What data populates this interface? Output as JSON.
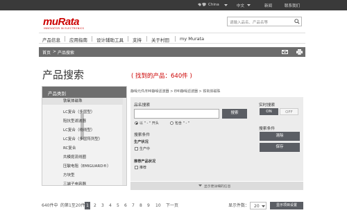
{
  "topbar": {
    "region": "China",
    "language": "中文",
    "news": "新闻",
    "contact": "联系我们"
  },
  "brand": {
    "logo": "muRata",
    "tagline": "INNOVATOR IN ELECTRONICS"
  },
  "search": {
    "placeholder": "请输入品名、产品名等"
  },
  "nav": {
    "items": [
      "产品信息",
      "应用指南",
      "设计辅助工具",
      "支持",
      "关于村田",
      "my Murata"
    ]
  },
  "breadcrumb": {
    "home": "首页",
    "current": "产品搜索"
  },
  "page": {
    "title": "产品搜索",
    "found": "( 找到的产品：640件 )"
  },
  "category": {
    "header": "产品类别",
    "items": [
      "铁氧体磁珠",
      "LC复合（多层型）",
      "阻抗型滤波器",
      "LC复合（绕线型）",
      "LC复合（多层阵列型）",
      "RC复合",
      "共模扼流线圈",
      "压敏电阻（EMIGUARD®）",
      "方块型",
      "三端子电容器"
    ],
    "selected_index": 0
  },
  "filter": {
    "path": "静噪元件/EMI静噪滤波器 > EMI静噪滤波器 > 铁氧体磁珠",
    "part_label": "品名搜索",
    "search_button": "搜索",
    "radio_prefix": "以 \" - \" 开头",
    "radio_contains": "包含 \" - \"",
    "conditions_label": "搜索条件",
    "status_label": "生产状况",
    "status_option": "生产中",
    "recommend_label": "推荐产品状况",
    "recommend_option": "推荐",
    "realtime_label": "实时搜索",
    "on": "ON",
    "off": "OFF",
    "saved_label": "搜索条件",
    "clear_button": "清除",
    "save_button": "保存",
    "show_more": "显示更详细的信息"
  },
  "pagination": {
    "count": "640件中",
    "range": "的第1至20件",
    "pages": [
      "1",
      "2",
      "3",
      "4",
      "5",
      "6",
      "7",
      "8",
      "9",
      "10"
    ],
    "current": "1",
    "next": "下一页",
    "per_page_label": "显示件数：",
    "per_page_value": "20",
    "display_button": "显示项目设置"
  }
}
